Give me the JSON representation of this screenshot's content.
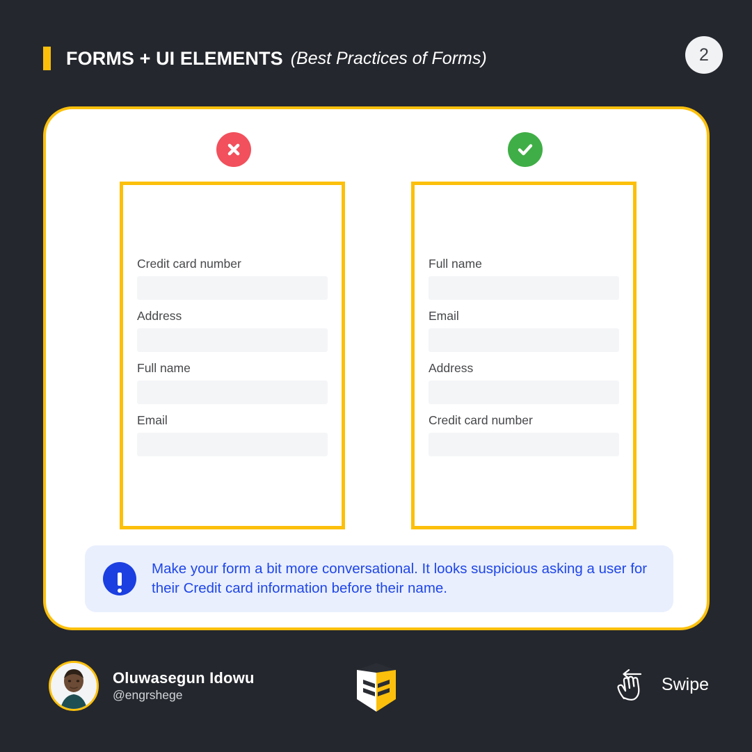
{
  "header": {
    "title_main": "FORMS + UI ELEMENTS",
    "title_sub": "(Best Practices of Forms)",
    "page_number": "2",
    "accent_color": "#fcc00c"
  },
  "comparison": {
    "bad": {
      "icon": "x-circle-icon",
      "icon_color": "#f1505c",
      "fields": [
        {
          "label": "Credit card number",
          "value": "",
          "placeholder": ""
        },
        {
          "label": "Address",
          "value": "",
          "placeholder": ""
        },
        {
          "label": "Full name",
          "value": "",
          "placeholder": ""
        },
        {
          "label": "Email",
          "value": "",
          "placeholder": ""
        }
      ]
    },
    "good": {
      "icon": "check-circle-icon",
      "icon_color": "#3fae46",
      "fields": [
        {
          "label": "Full name",
          "value": "",
          "placeholder": ""
        },
        {
          "label": "Email",
          "value": "",
          "placeholder": ""
        },
        {
          "label": "Address",
          "value": "",
          "placeholder": ""
        },
        {
          "label": "Credit card number",
          "value": "",
          "placeholder": ""
        }
      ]
    }
  },
  "callout": {
    "icon": "exclamation-circle-icon",
    "icon_color": "#1b3fe0",
    "text_color": "#1f46e8",
    "background": "#e9effd",
    "text": "Make your form a bit more conversational. It looks suspicious asking a user for their Credit card information before their name."
  },
  "footer": {
    "author_name": "Oluwasegun Idowu",
    "author_handle": "@engrshege",
    "avatar": "profile-photo",
    "brand_logo": "es-monogram-logo",
    "swipe_label": "Swipe",
    "swipe_icon": "swipe-hand-left-icon"
  },
  "theme": {
    "background": "#24272d",
    "card_background": "#ffffff",
    "gold": "#fcc00c",
    "input_background": "#f4f5f7",
    "label_color": "#46474a"
  }
}
